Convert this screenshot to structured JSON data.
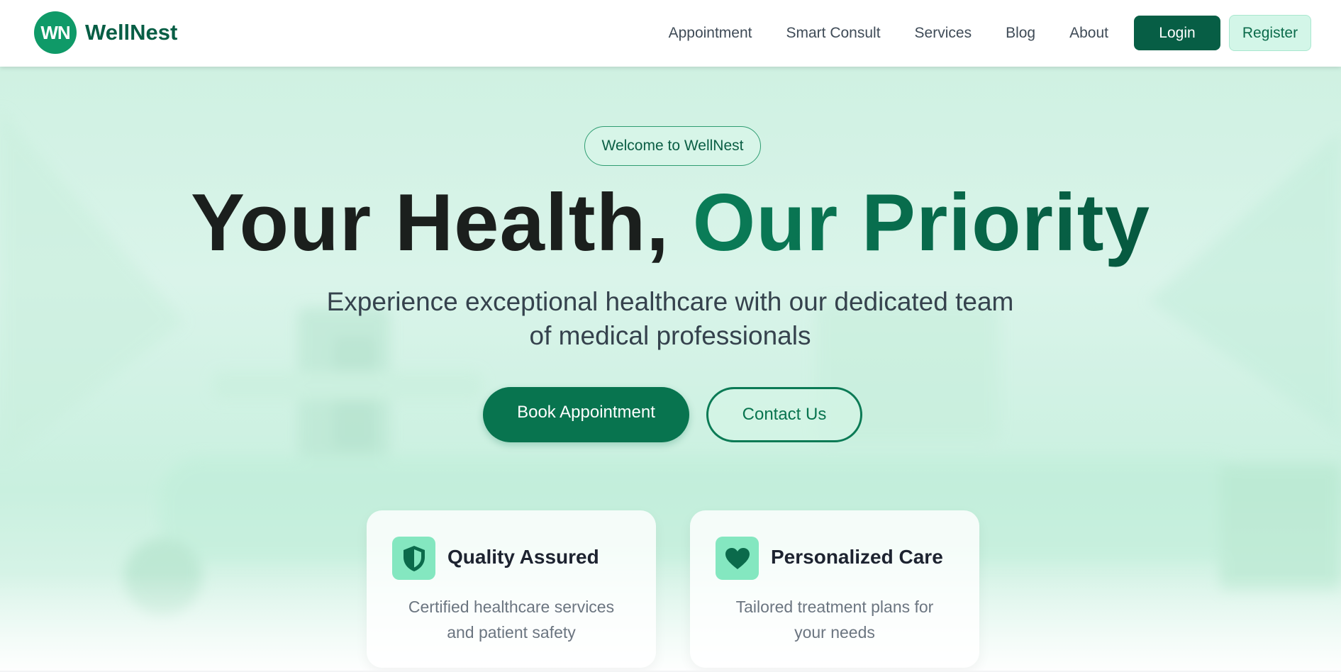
{
  "header": {
    "logo_initials": "WN",
    "brand_name": "WellNest",
    "nav": [
      {
        "label": "Appointment"
      },
      {
        "label": "Smart Consult"
      },
      {
        "label": "Services"
      },
      {
        "label": "Blog"
      },
      {
        "label": "About"
      }
    ],
    "login_label": "Login",
    "register_label": "Register"
  },
  "hero": {
    "welcome": "Welcome to WellNest",
    "headline_dark": "Your Health, ",
    "headline_accent": "Our Priority",
    "subtitle": "Experience exceptional healthcare with our dedicated team of medical professionals",
    "book_label": "Book Appointment",
    "contact_label": "Contact Us"
  },
  "features": [
    {
      "icon": "shield-icon",
      "title": "Quality Assured",
      "desc": "Certified healthcare services and patient safety"
    },
    {
      "icon": "heart-icon",
      "title": "Personalized Care",
      "desc": "Tailored treatment plans for your needs"
    }
  ],
  "colors": {
    "brand": "#0f9a68",
    "primary": "#075e45",
    "accent": "#08744f",
    "hero_bg": "#cff1e2",
    "icon_bg": "#84e7c0"
  }
}
